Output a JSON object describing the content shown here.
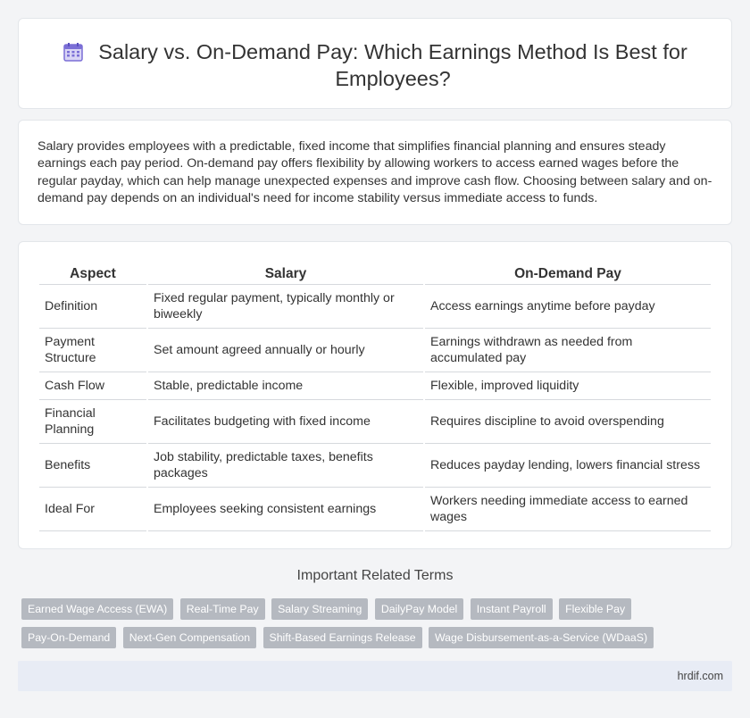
{
  "header": {
    "title": "Salary vs. On-Demand Pay: Which Earnings Method Is Best for Employees?",
    "icon": "calendar-icon"
  },
  "intro": {
    "text": "Salary provides employees with a predictable, fixed income that simplifies financial planning and ensures steady earnings each pay period. On-demand pay offers flexibility by allowing workers to access earned wages before the regular payday, which can help manage unexpected expenses and improve cash flow. Choosing between salary and on-demand pay depends on an individual's need for income stability versus immediate access to funds."
  },
  "table": {
    "headers": [
      "Aspect",
      "Salary",
      "On-Demand Pay"
    ],
    "rows": [
      [
        "Definition",
        "Fixed regular payment, typically monthly or biweekly",
        "Access earnings anytime before payday"
      ],
      [
        "Payment Structure",
        "Set amount agreed annually or hourly",
        "Earnings withdrawn as needed from accumulated pay"
      ],
      [
        "Cash Flow",
        "Stable, predictable income",
        "Flexible, improved liquidity"
      ],
      [
        "Financial Planning",
        "Facilitates budgeting with fixed income",
        "Requires discipline to avoid overspending"
      ],
      [
        "Benefits",
        "Job stability, predictable taxes, benefits packages",
        "Reduces payday lending, lowers financial stress"
      ],
      [
        "Ideal For",
        "Employees seeking consistent earnings",
        "Workers needing immediate access to earned wages"
      ]
    ]
  },
  "related": {
    "title": "Important Related Terms",
    "tags": [
      "Earned Wage Access (EWA)",
      "Real-Time Pay",
      "Salary Streaming",
      "DailyPay Model",
      "Instant Payroll",
      "Flexible Pay",
      "Pay-On-Demand",
      "Next-Gen Compensation",
      "Shift-Based Earnings Release",
      "Wage Disbursement-as-a-Service (WDaaS)"
    ]
  },
  "footer": {
    "site": "hrdif.com"
  },
  "colors": {
    "tag_bg": "#b5b9c0",
    "footer_bg": "#e8ecf5",
    "icon_accent": "#7b6fd6"
  }
}
